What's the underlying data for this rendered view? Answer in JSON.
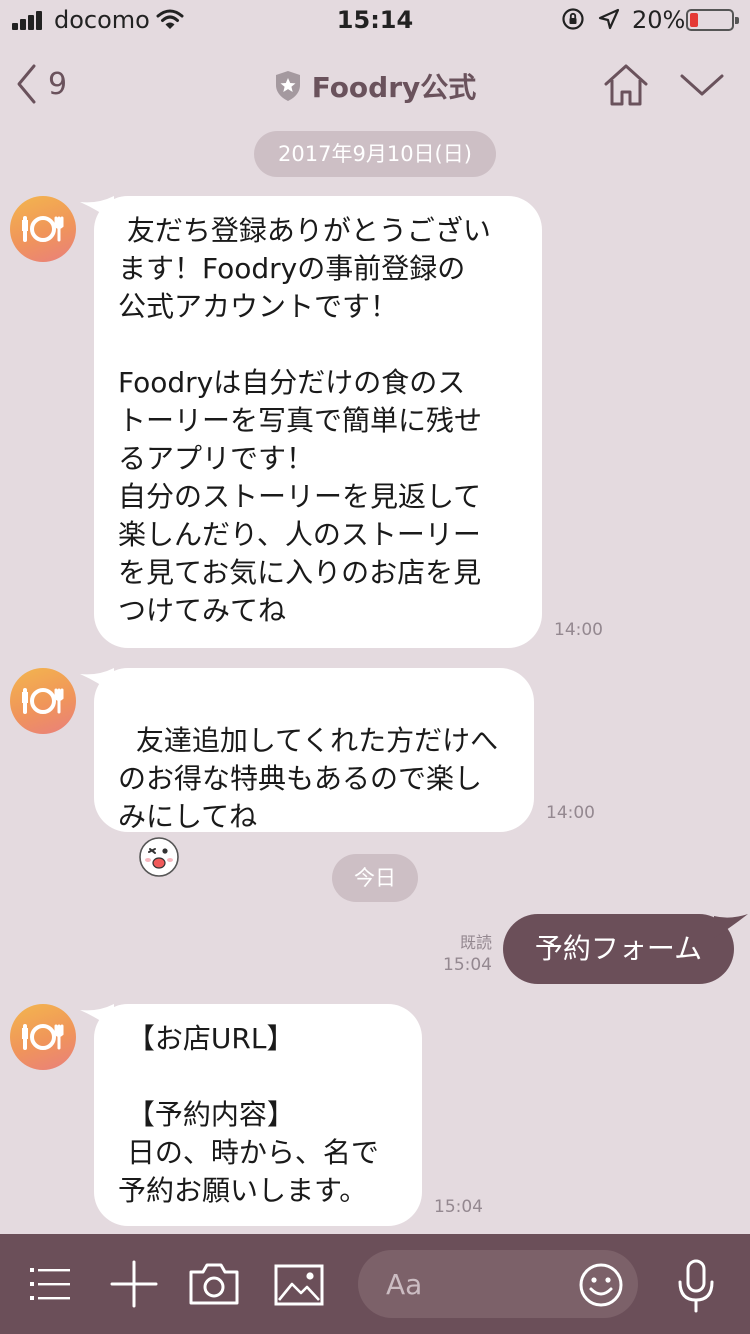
{
  "status_bar": {
    "carrier": "docomo",
    "time": "15:14",
    "battery_percent": "20%",
    "battery_level": 0.2
  },
  "header": {
    "back_count": "9",
    "title": "Foodry公式",
    "icons": [
      "chevron-left-icon",
      "shield-star-icon",
      "home-icon",
      "chevron-down-icon"
    ]
  },
  "dates": {
    "first": "2017年9月10日(日)",
    "today": "今日"
  },
  "messages": [
    {
      "sender": "Foodry公式",
      "text": " 友だち登録ありがとうござい\nます！Foodryの事前登録の\n公式アカウントです！\n\nFoodryは自分だけの食のス\nトーリーを写真で簡単に残せ\nるアプリです！\n自分のストーリーを見返して\n楽しんだり、人のストーリー\nを見てお気に入りのお店を見\nつけてみてね",
      "time": "14:00"
    },
    {
      "sender": "Foodry公式",
      "text": "友達追加してくれた方だけへ\nのお得な特典もあるので楽し\nみにしてね",
      "time": "14:00"
    },
    {
      "sender": "me",
      "text": "予約フォーム",
      "read_label": "既読",
      "time": "15:04"
    },
    {
      "sender": "Foodry公式",
      "text": " 【お店URL】\n\n 【予約内容】\n 日の、時から、名で\n予約お願いします。",
      "time": "15:04"
    }
  ],
  "input_bar": {
    "placeholder": "Aa",
    "icons": [
      "menu-icon",
      "plus-icon",
      "camera-icon",
      "image-icon",
      "emoji-icon",
      "microphone-icon"
    ]
  },
  "colors": {
    "background": "#e4dadf",
    "accent": "#6b4f59",
    "battery_low": "#e53935",
    "avatar_gradient": [
      "#f3b64e",
      "#e97f7c"
    ]
  }
}
